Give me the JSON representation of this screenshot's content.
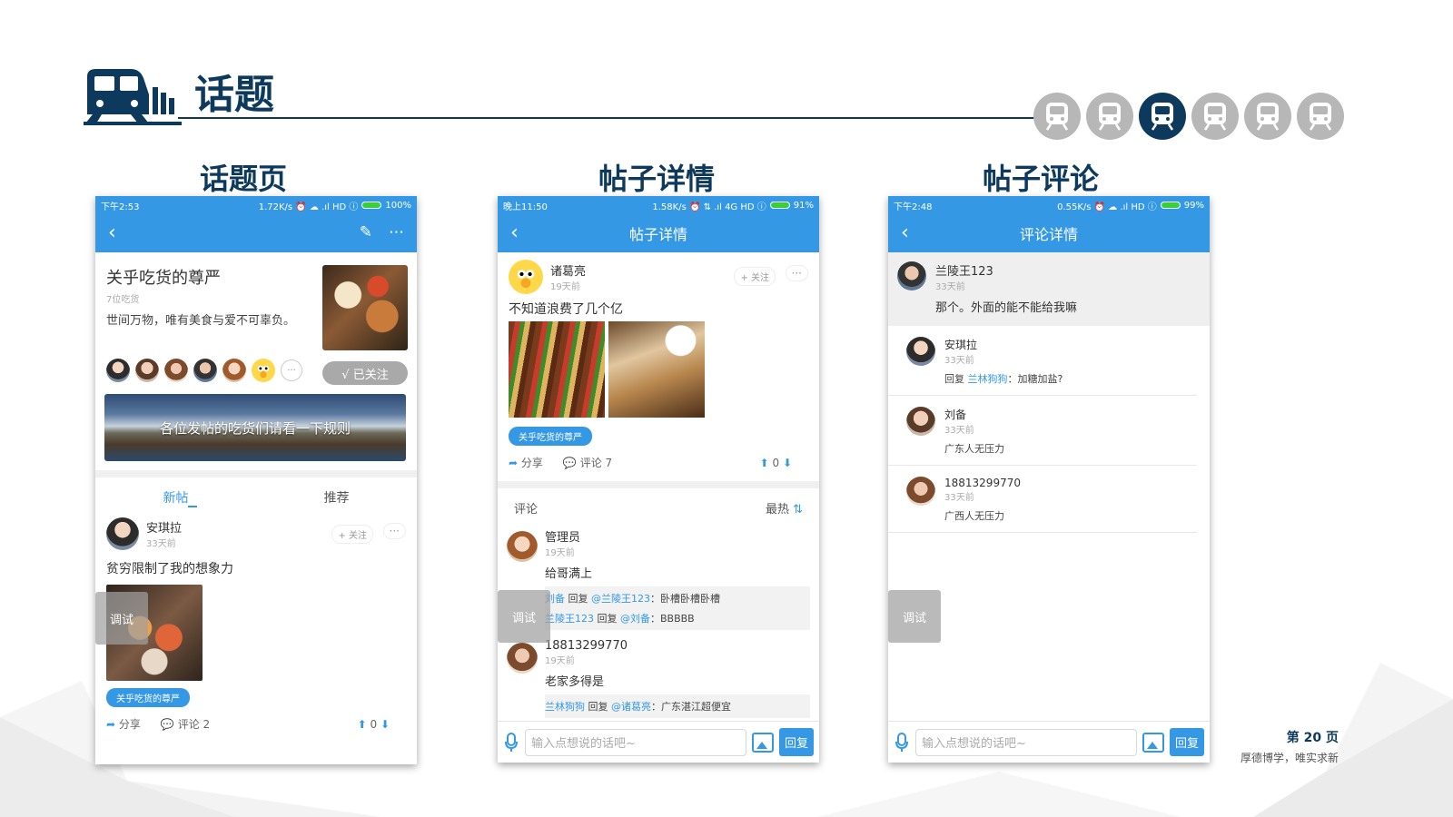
{
  "slide": {
    "title": "话题",
    "page_number": "第 20 页",
    "motto": "厚德博学，唯实求新",
    "progress": {
      "total": 6,
      "active_index": 2
    },
    "colors": {
      "brand_dark": "#0d3a5c",
      "app_blue": "#3598e5",
      "inactive": "#b7b7b7"
    }
  },
  "panels": [
    {
      "label": "话题页"
    },
    {
      "label": "帖子详情"
    },
    {
      "label": "帖子评论"
    }
  ],
  "topic_page": {
    "status": {
      "time": "下午2:53",
      "right": "1.72K/s ⏰ ☁ .ıl HD ⓘ",
      "battery": "100%"
    },
    "topic": {
      "name": "关乎吃货的尊严",
      "members": "7位吃货",
      "desc": "世间万物，唯有美食与爱不可辜负。"
    },
    "follow_label": "√ 已关注",
    "more_label": "···",
    "banner_text": "各位发帖的吃货们请看一下规则",
    "tabs": [
      "新帖",
      "推荐"
    ],
    "post": {
      "author": "安琪拉",
      "time": "33天前",
      "follow": "+ 关注",
      "more": "···",
      "text": "贫穷限制了我的想象力",
      "tag": "关乎吃货的尊严",
      "share": "分享",
      "comment": "评论 2",
      "votes": "0"
    },
    "debug_label": "调试"
  },
  "detail_page": {
    "status": {
      "time": "晚上11:50",
      "right": "1.58K/s ⏰ ⇅ .ıl 4G HD ⓘ",
      "battery": "91%"
    },
    "nav_title": "帖子详情",
    "post": {
      "author": "诸葛亮",
      "time": "19天前",
      "follow": "+ 关注",
      "more": "···",
      "text": "不知道浪费了几个亿",
      "tag": "关乎吃货的尊严",
      "share": "分享",
      "comment": "评论 7",
      "votes": "0"
    },
    "comments_header": "评论",
    "sort_label": "最热",
    "comments": [
      {
        "author": "管理员",
        "time": "19天前",
        "text": "给哥满上",
        "replies": [
          {
            "from": "刘备",
            "verb": "回复",
            "to": "@兰陵王123",
            "text": "：卧槽卧槽卧槽"
          },
          {
            "from": "兰陵王123",
            "verb": "回复",
            "to": "@刘备",
            "text": "：BBBBB"
          }
        ]
      },
      {
        "author": "18813299770",
        "time": "19天前",
        "text": "老家多得是",
        "replies": [
          {
            "from": "兰林狗狗",
            "verb": "回复",
            "to": "@诸葛亮",
            "text": "：广东湛江超便宜"
          }
        ]
      }
    ],
    "input_placeholder": "输入点想说的话吧~",
    "reply_label": "回复",
    "debug_label": "调试"
  },
  "comments_page": {
    "status": {
      "time": "下午2:48",
      "right": "0.55K/s ⏰ ☁ .ıl HD ⓘ",
      "battery": "99%"
    },
    "nav_title": "评论详情",
    "main_comment": {
      "author": "兰陵王123",
      "time": "33天前",
      "text": "那个。外面的能不能给我嘛"
    },
    "replies": [
      {
        "author": "安琪拉",
        "time": "33天前",
        "prefix": "回复 ",
        "mention": "兰林狗狗",
        "text": "：加糖加盐?"
      },
      {
        "author": "刘备",
        "time": "33天前",
        "prefix": "",
        "mention": "",
        "text": "广东人无压力"
      },
      {
        "author": "18813299770",
        "time": "33天前",
        "prefix": "",
        "mention": "",
        "text": "广西人无压力"
      }
    ],
    "input_placeholder": "输入点想说的话吧~",
    "reply_label": "回复",
    "debug_label": "调试"
  }
}
